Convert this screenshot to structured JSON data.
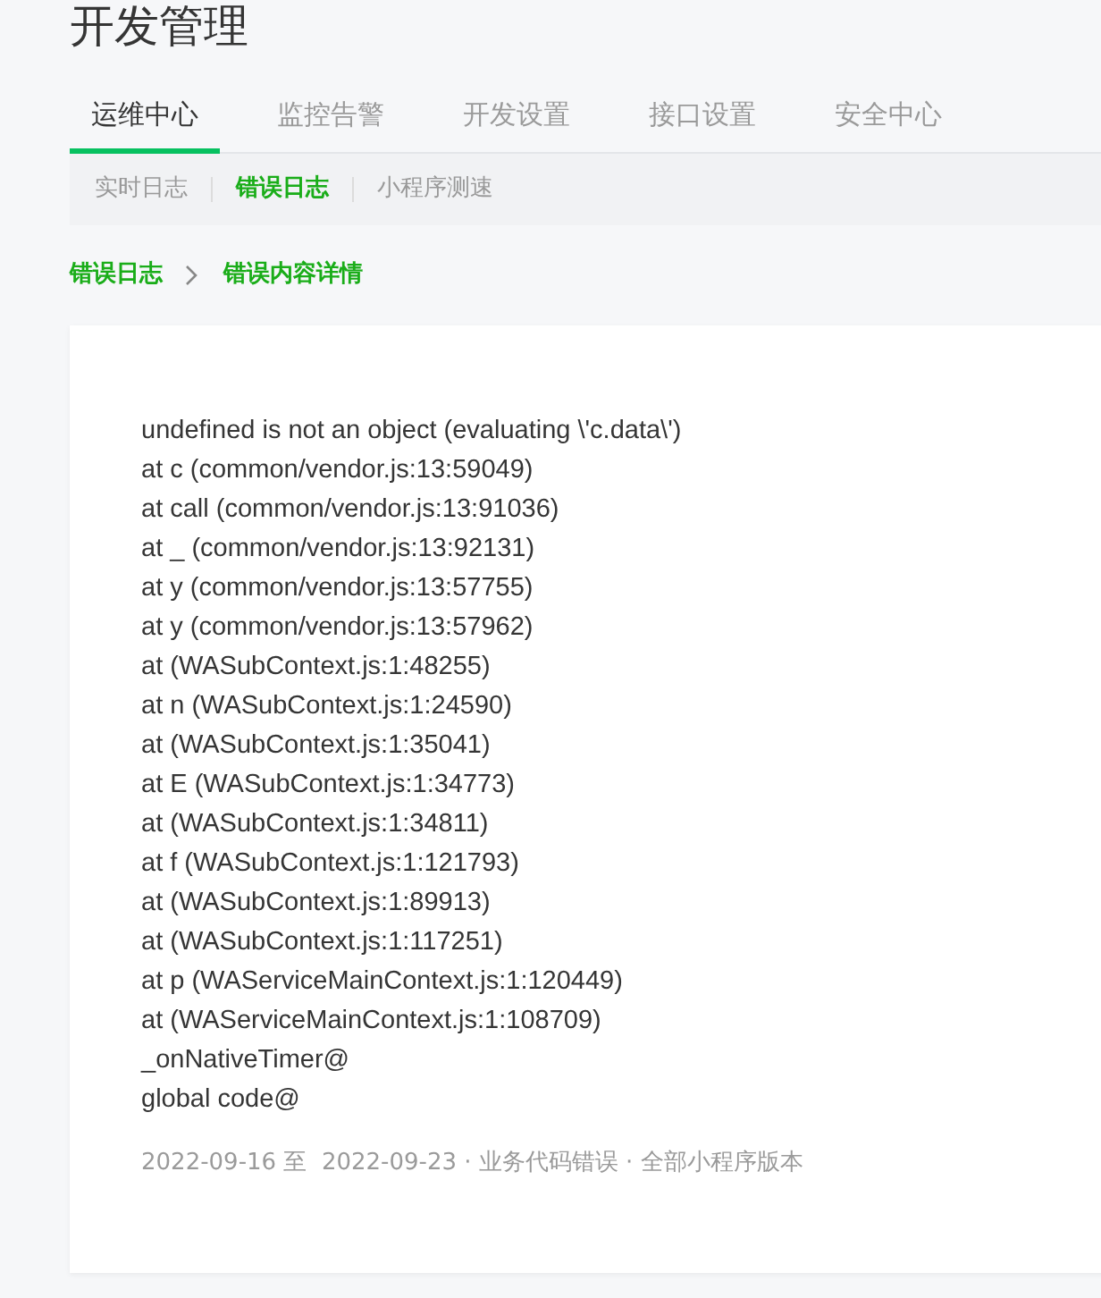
{
  "page_title": "开发管理",
  "tabs": [
    {
      "label": "运维中心",
      "selected": true
    },
    {
      "label": "监控告警",
      "selected": false
    },
    {
      "label": "开发设置",
      "selected": false
    },
    {
      "label": "接口设置",
      "selected": false
    },
    {
      "label": "安全中心",
      "selected": false
    }
  ],
  "subtabs": [
    {
      "label": "实时日志",
      "selected": false
    },
    {
      "label": "错误日志",
      "selected": true
    },
    {
      "label": "小程序测速",
      "selected": false
    }
  ],
  "breadcrumb": [
    "错误日志",
    "错误内容详情"
  ],
  "error_lines": [
    "undefined is not an object (evaluating \\'c.data\\')",
    "at c (common/vendor.js:13:59049)",
    "at call (common/vendor.js:13:91036)",
    "at _ (common/vendor.js:13:92131)",
    "at y (common/vendor.js:13:57755)",
    "at y (common/vendor.js:13:57962)",
    "at (WASubContext.js:1:48255)",
    "at n (WASubContext.js:1:24590)",
    "at (WASubContext.js:1:35041)",
    "at E (WASubContext.js:1:34773)",
    "at (WASubContext.js:1:34811)",
    "at f (WASubContext.js:1:121793)",
    "at (WASubContext.js:1:89913)",
    "at (WASubContext.js:1:117251)",
    "at p (WAServiceMainContext.js:1:120449)",
    "at (WAServiceMainContext.js:1:108709)",
    "_onNativeTimer@",
    "global code@"
  ],
  "meta": "2022-09-16 至  2022-09-23 · 业务代码错误 · 全部小程序版本"
}
